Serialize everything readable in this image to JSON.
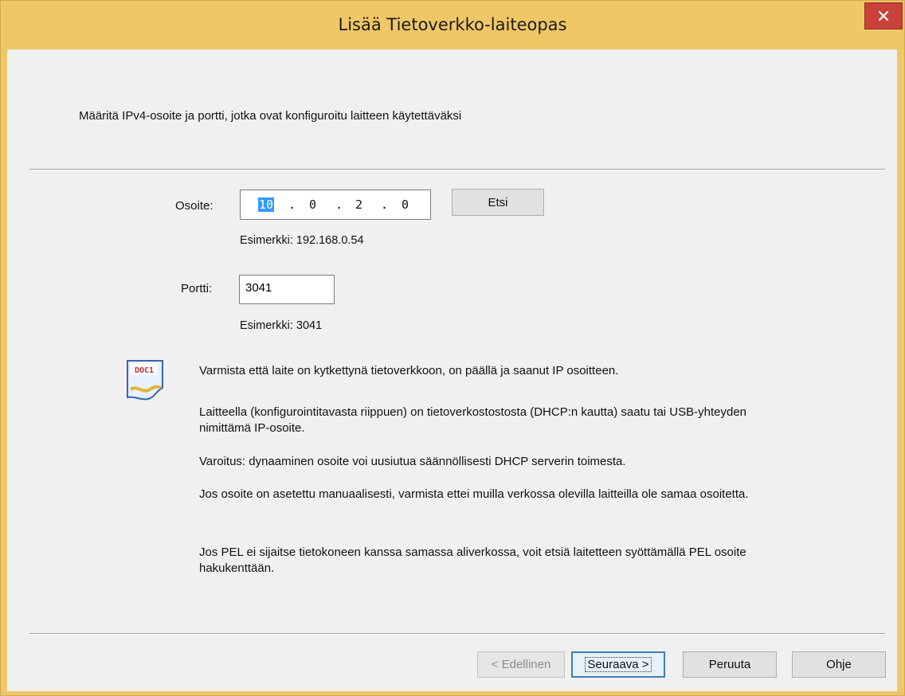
{
  "window": {
    "title": "Lisää Tietoverkko-laiteopas",
    "close_label": "×"
  },
  "heading": "Määritä IPv4-osoite ja portti, jotka ovat konfiguroitu laitteen käytettäväksi",
  "address": {
    "label": "Osoite:",
    "octets": [
      "10",
      "0",
      "2",
      "0"
    ],
    "separator": ".",
    "hint": "Esimerkki: 192.168.0.54",
    "search_button": "Etsi"
  },
  "port": {
    "label": "Portti:",
    "value": "3041",
    "hint": "Esimerkki: 3041"
  },
  "info": {
    "icon_text": "DOC1",
    "p1": "Varmista että laite on kytkettynä tietoverkkoon, on päällä ja saanut IP osoitteen.",
    "p2a": "Laitteella (konfigurointitavasta riippuen) on tietoverkostostosta (DHCP:n kautta) saatu tai USB-yhteyden",
    "p2b": "nimittämä IP-osoite.",
    "p3": "Varoitus: dynaaminen osoite voi uusiutua säännöllisesti DHCP serverin toimesta.",
    "p4": "Jos osoite on asetettu manuaalisesti, varmista ettei muilla verkossa olevilla laitteilla ole samaa osoitetta.",
    "p5a": "Jos PEL ei sijaitse tietokoneen kanssa samassa aliverkossa, voit etsiä laitetteen syöttämällä PEL osoite",
    "p5b": "hakukenttään."
  },
  "footer": {
    "back": "< Edellinen",
    "next": "Seuraava >",
    "cancel": "Peruuta",
    "help": "Ohje"
  },
  "colors": {
    "titlebar": "#f0c766",
    "close": "#c8413a",
    "client": "#f0f0f0",
    "selection": "#3399ff"
  }
}
